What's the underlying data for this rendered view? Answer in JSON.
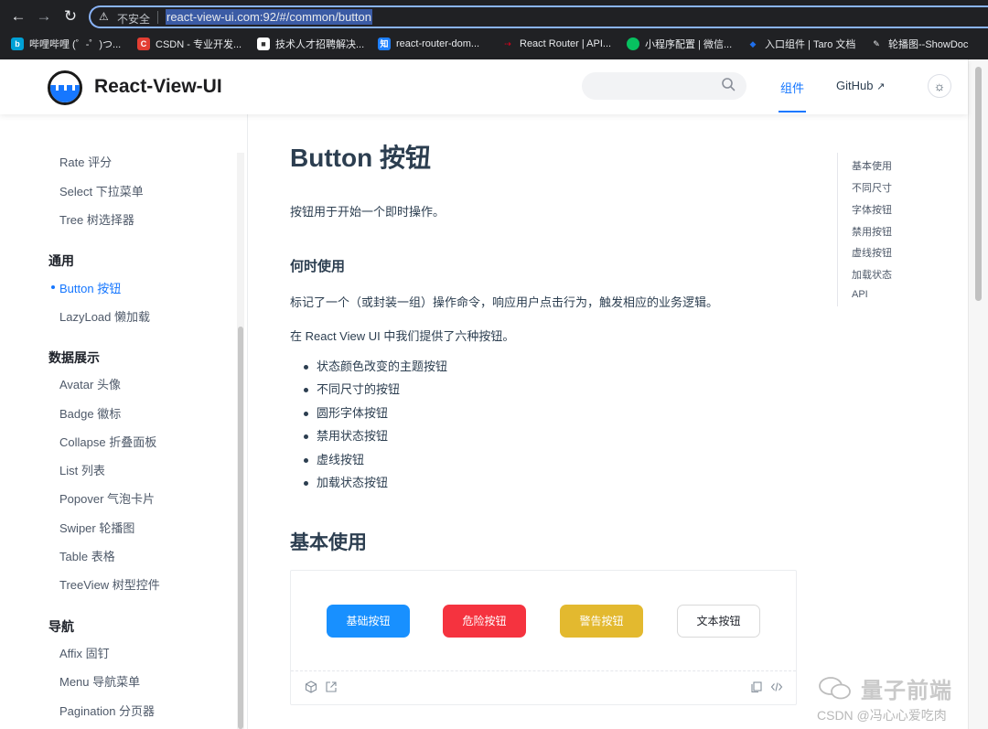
{
  "browser": {
    "insecure_label": "不安全",
    "url": "react-view-ui.com:92/#/common/button",
    "bookmarks": [
      {
        "label": "哔哩哔哩 (゜-゜)つ...",
        "color": "#00a1d6",
        "glyph": "b"
      },
      {
        "label": "CSDN - 专业开发...",
        "color": "#e33e33",
        "glyph": "C"
      },
      {
        "label": "技术人才招聘解决...",
        "color": "#ffffff",
        "glyph": "🐮"
      },
      {
        "label": "react-router-dom...",
        "color": "#1e80ff",
        "glyph": "知"
      },
      {
        "label": "React Router | API...",
        "color": "#d0021b",
        "glyph": "⇢"
      },
      {
        "label": "小程序配置 | 微信...",
        "color": "#07c160",
        "glyph": "•"
      },
      {
        "label": "入口组件 | Taro 文档",
        "color": "#1f6feb",
        "glyph": "◆"
      },
      {
        "label": "轮播图--ShowDoc",
        "color": "#333333",
        "glyph": "✎"
      }
    ]
  },
  "header": {
    "brand": "React-View-UI",
    "nav_components": "组件",
    "nav_github": "GitHub",
    "external_link_icon": "external-link-icon",
    "search_icon": "search-icon",
    "theme_icon": "sun-icon"
  },
  "sidebar": {
    "top_items": [
      "Rate 评分",
      "Select 下拉菜单",
      "Tree 树选择器"
    ],
    "group_general": "通用",
    "general_items": [
      "Button 按钮",
      "LazyLoad 懒加载"
    ],
    "active_item": "Button 按钮",
    "group_display": "数据展示",
    "display_items": [
      "Avatar 头像",
      "Badge 徽标",
      "Collapse 折叠面板",
      "List 列表",
      "Popover 气泡卡片",
      "Swiper 轮播图",
      "Table 表格",
      "TreeView 树型控件"
    ],
    "group_nav": "导航",
    "nav_items": [
      "Affix 固钉",
      "Menu 导航菜单",
      "Pagination 分页器"
    ]
  },
  "main": {
    "title": "Button 按钮",
    "intro": "按钮用于开始一个即时操作。",
    "when_heading": "何时使用",
    "when_text": "标记了一个（或封装一组）操作命令，响应用户点击行为，触发相应的业务逻辑。",
    "provide_text": "在 React View UI 中我们提供了六种按钮。",
    "bullets": [
      "状态颜色改变的主题按钮",
      "不同尺寸的按钮",
      "圆形字体按钮",
      "禁用状态按钮",
      "虚线按钮",
      "加载状态按钮"
    ],
    "basic_heading": "基本使用",
    "demo_buttons": {
      "primary": "基础按钮",
      "danger": "危险按钮",
      "warning": "警告按钮",
      "text": "文本按钮"
    }
  },
  "toc": [
    "基本使用",
    "不同尺寸",
    "字体按钮",
    "禁用按钮",
    "虚线按钮",
    "加载状态",
    "API"
  ],
  "watermark": {
    "title": "量子前端",
    "csdn": "CSDN @冯心心爱吃肉"
  },
  "colors": {
    "accent": "#1677ff",
    "primary_button": "#1890ff",
    "danger_button": "#f5333f",
    "warning_button": "#e3b92f"
  }
}
